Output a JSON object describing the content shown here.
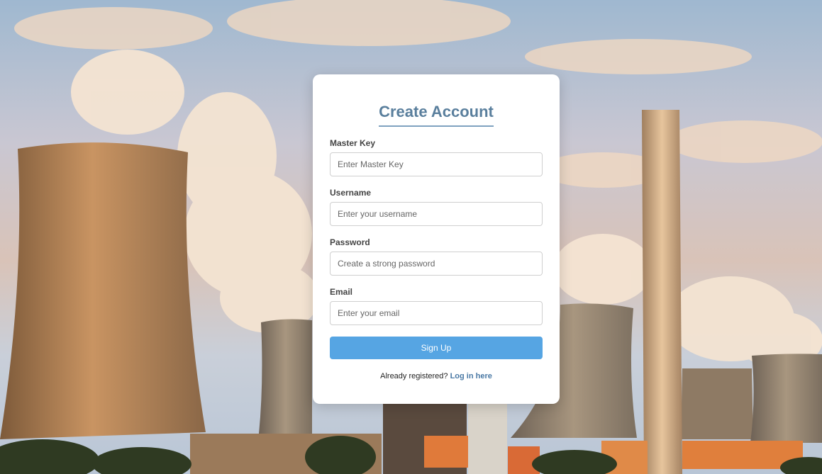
{
  "form": {
    "title": "Create Account",
    "fields": [
      {
        "label": "Master Key",
        "placeholder": "Enter Master Key",
        "type": "text"
      },
      {
        "label": "Username",
        "placeholder": "Enter your username",
        "type": "text"
      },
      {
        "label": "Password",
        "placeholder": "Create a strong password",
        "type": "password"
      },
      {
        "label": "Email",
        "placeholder": "Enter your email",
        "type": "email"
      }
    ],
    "submit_label": "Sign Up",
    "footer_text": "Already registered?",
    "footer_link": "Log in here"
  },
  "colors": {
    "accent": "#56a5e3",
    "title": "#5a7f9d",
    "link": "#4a79a5"
  }
}
